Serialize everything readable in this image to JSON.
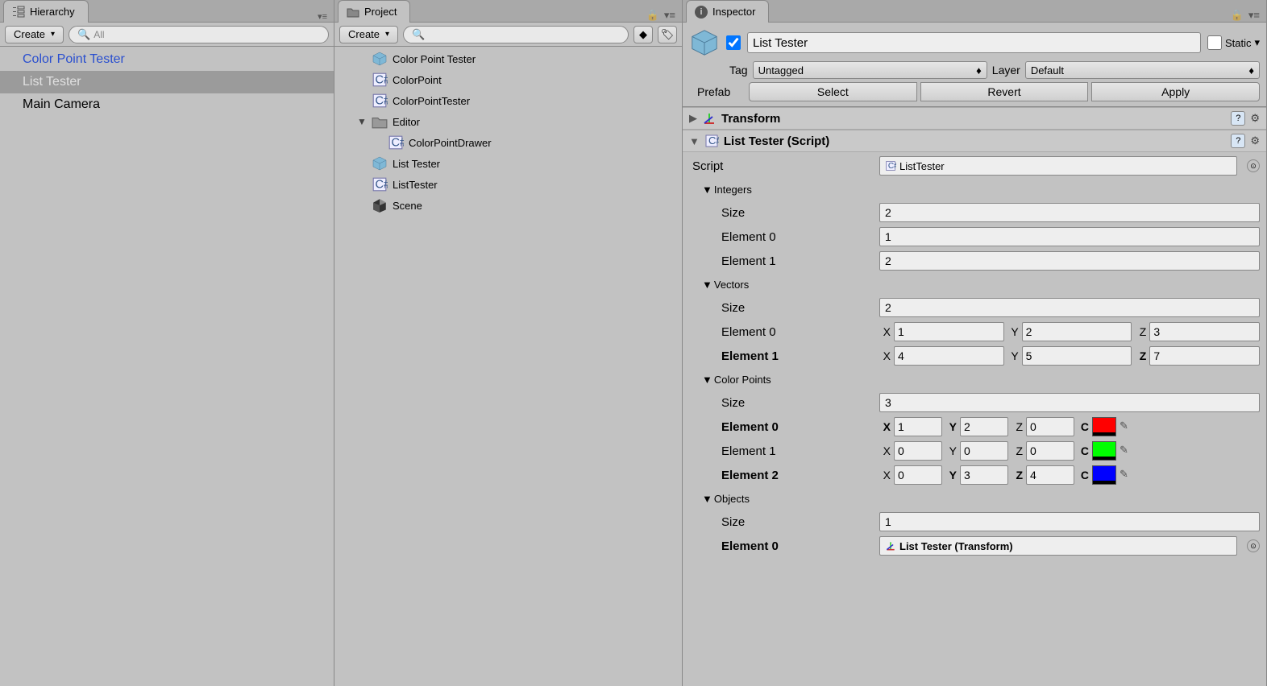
{
  "hierarchy": {
    "title": "Hierarchy",
    "create": "Create",
    "searchPrefix": "All",
    "items": [
      {
        "label": "Color Point Tester",
        "style": "link"
      },
      {
        "label": "List Tester",
        "style": "sel"
      },
      {
        "label": "Main Camera",
        "style": ""
      }
    ]
  },
  "project": {
    "title": "Project",
    "create": "Create",
    "items": [
      {
        "label": "Color Point Tester",
        "icon": "prefab",
        "indent": 0
      },
      {
        "label": "ColorPoint",
        "icon": "cs",
        "indent": 0
      },
      {
        "label": "ColorPointTester",
        "icon": "cs",
        "indent": 0
      },
      {
        "label": "Editor",
        "icon": "folder",
        "indent": 0,
        "fold": "open"
      },
      {
        "label": "ColorPointDrawer",
        "icon": "cs",
        "indent": 1
      },
      {
        "label": "List Tester",
        "icon": "prefab",
        "indent": 0
      },
      {
        "label": "ListTester",
        "icon": "cs",
        "indent": 0
      },
      {
        "label": "Scene",
        "icon": "unity",
        "indent": 0
      }
    ]
  },
  "inspector": {
    "title": "Inspector",
    "name": "List Tester",
    "static": "Static",
    "tagLabel": "Tag",
    "tag": "Untagged",
    "layerLabel": "Layer",
    "layer": "Default",
    "prefabLabel": "Prefab",
    "prefab": {
      "select": "Select",
      "revert": "Revert",
      "apply": "Apply"
    },
    "transform": "Transform",
    "script": {
      "title": "List Tester (Script)",
      "scriptLabel": "Script",
      "scriptValue": "ListTester"
    },
    "integers": {
      "head": "Integers",
      "sizeLabel": "Size",
      "size": "2",
      "rows": [
        {
          "label": "Element 0",
          "value": "1"
        },
        {
          "label": "Element 1",
          "value": "2"
        }
      ]
    },
    "vectors": {
      "head": "Vectors",
      "sizeLabel": "Size",
      "size": "2",
      "rows": [
        {
          "label": "Element 0",
          "x": "1",
          "y": "2",
          "z": "3",
          "bold": false,
          "bx": false,
          "by": false,
          "bz": false
        },
        {
          "label": "Element 1",
          "x": "4",
          "y": "5",
          "z": "7",
          "bold": true,
          "bx": false,
          "by": false,
          "bz": true
        }
      ]
    },
    "colorpoints": {
      "head": "Color Points",
      "sizeLabel": "Size",
      "size": "3",
      "rows": [
        {
          "label": "Element 0",
          "x": "1",
          "y": "2",
          "z": "0",
          "color": "#ff0000",
          "bold": true,
          "bx": true,
          "by": true,
          "bz": false,
          "bc": true
        },
        {
          "label": "Element 1",
          "x": "0",
          "y": "0",
          "z": "0",
          "color": "#00ff00",
          "bold": false,
          "bx": false,
          "by": false,
          "bz": false,
          "bc": true
        },
        {
          "label": "Element 2",
          "x": "0",
          "y": "3",
          "z": "4",
          "color": "#0000ff",
          "bold": true,
          "bx": false,
          "by": true,
          "bz": true,
          "bc": true
        }
      ]
    },
    "objects": {
      "head": "Objects",
      "sizeLabel": "Size",
      "size": "1",
      "el0Label": "Element 0",
      "el0Value": "List Tester (Transform)"
    }
  }
}
